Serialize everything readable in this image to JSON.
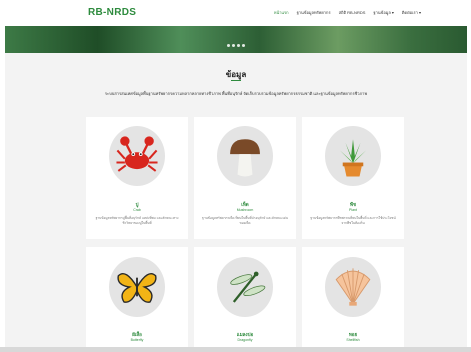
{
  "brand": "RB-NRDS",
  "nav": [
    {
      "label": "หน้าแรก",
      "active": true
    },
    {
      "label": "ฐานข้อมูลทรัพยากร",
      "active": false
    },
    {
      "label": "สถิติ RB-NRDS",
      "active": false
    },
    {
      "label": "ฐานข้อมูล ▾",
      "active": false
    },
    {
      "label": "ติดต่อเรา ▾",
      "active": false
    }
  ],
  "section": {
    "title": "ข้อมูล",
    "description": "ระบบสารสนเทศข้อมูลพื้นฐานทรัพยากรความหลากหลายทางชีวภาพ พื้นที่อนุรักษ์ จัดเก็บรวบรวมข้อมูลทรัพยากรธรรมชาติ และฐานข้อมูลทรัพยากรชีวภาพ"
  },
  "cards": [
    {
      "icon": "crab-icon",
      "label": "ปู",
      "sub": "Crab",
      "text": "ฐานข้อมูลทรัพยากรปูพื้นที่อนุรักษ์ แหล่งที่พบ และลักษณะทางชีววิทยาของปูในพื้นที่"
    },
    {
      "icon": "mushroom-icon",
      "label": "เห็ด",
      "sub": "Mushroom",
      "text": "ฐานข้อมูลทรัพยากรเห็ด ที่พบในพื้นที่ป่าอนุรักษ์ และลักษณะเด่นของเห็ด"
    },
    {
      "icon": "plant-icon",
      "label": "พืช",
      "sub": "Plant",
      "text": "ฐานข้อมูลทรัพยากรพืชพรรณที่พบในพื้นที่ และการใช้ประโยชน์จากพืชในท้องถิ่น"
    },
    {
      "icon": "butterfly-icon",
      "label": "ผีเสื้อ",
      "sub": "Butterfly",
      "text": ""
    },
    {
      "icon": "dragonfly-icon",
      "label": "แมลงปอ",
      "sub": "Dragonfly",
      "text": ""
    },
    {
      "icon": "shell-icon",
      "label": "หอย",
      "sub": "Shellfish",
      "text": ""
    }
  ],
  "colors": {
    "accent": "#2e8b3e",
    "banner": "#3d7a46",
    "background": "#f3f3f3"
  }
}
